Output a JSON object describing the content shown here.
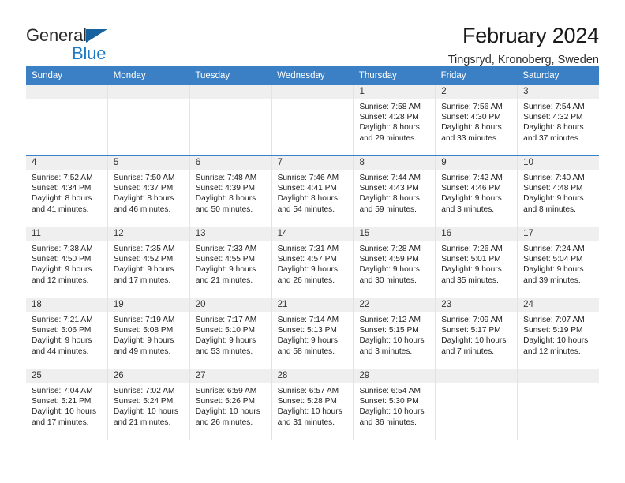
{
  "brand": {
    "name_part1": "General",
    "name_part2": "Blue",
    "triangle_color": "#15629f",
    "blue_color": "#1f7ac4"
  },
  "header": {
    "title": "February 2024",
    "subtitle": "Tingsryd, Kronoberg, Sweden"
  },
  "theme": {
    "header_blue": "#3b7fc4",
    "day_band_gray": "#efefef",
    "cell_border": "#e3e3e3"
  },
  "weekdays": [
    "Sunday",
    "Monday",
    "Tuesday",
    "Wednesday",
    "Thursday",
    "Friday",
    "Saturday"
  ],
  "weeks": [
    [
      {
        "date": "",
        "sunrise": "",
        "sunset": "",
        "daylight_line1": "",
        "daylight_line2": ""
      },
      {
        "date": "",
        "sunrise": "",
        "sunset": "",
        "daylight_line1": "",
        "daylight_line2": ""
      },
      {
        "date": "",
        "sunrise": "",
        "sunset": "",
        "daylight_line1": "",
        "daylight_line2": ""
      },
      {
        "date": "",
        "sunrise": "",
        "sunset": "",
        "daylight_line1": "",
        "daylight_line2": ""
      },
      {
        "date": "1",
        "sunrise": "Sunrise: 7:58 AM",
        "sunset": "Sunset: 4:28 PM",
        "daylight_line1": "Daylight: 8 hours",
        "daylight_line2": "and 29 minutes."
      },
      {
        "date": "2",
        "sunrise": "Sunrise: 7:56 AM",
        "sunset": "Sunset: 4:30 PM",
        "daylight_line1": "Daylight: 8 hours",
        "daylight_line2": "and 33 minutes."
      },
      {
        "date": "3",
        "sunrise": "Sunrise: 7:54 AM",
        "sunset": "Sunset: 4:32 PM",
        "daylight_line1": "Daylight: 8 hours",
        "daylight_line2": "and 37 minutes."
      }
    ],
    [
      {
        "date": "4",
        "sunrise": "Sunrise: 7:52 AM",
        "sunset": "Sunset: 4:34 PM",
        "daylight_line1": "Daylight: 8 hours",
        "daylight_line2": "and 41 minutes."
      },
      {
        "date": "5",
        "sunrise": "Sunrise: 7:50 AM",
        "sunset": "Sunset: 4:37 PM",
        "daylight_line1": "Daylight: 8 hours",
        "daylight_line2": "and 46 minutes."
      },
      {
        "date": "6",
        "sunrise": "Sunrise: 7:48 AM",
        "sunset": "Sunset: 4:39 PM",
        "daylight_line1": "Daylight: 8 hours",
        "daylight_line2": "and 50 minutes."
      },
      {
        "date": "7",
        "sunrise": "Sunrise: 7:46 AM",
        "sunset": "Sunset: 4:41 PM",
        "daylight_line1": "Daylight: 8 hours",
        "daylight_line2": "and 54 minutes."
      },
      {
        "date": "8",
        "sunrise": "Sunrise: 7:44 AM",
        "sunset": "Sunset: 4:43 PM",
        "daylight_line1": "Daylight: 8 hours",
        "daylight_line2": "and 59 minutes."
      },
      {
        "date": "9",
        "sunrise": "Sunrise: 7:42 AM",
        "sunset": "Sunset: 4:46 PM",
        "daylight_line1": "Daylight: 9 hours",
        "daylight_line2": "and 3 minutes."
      },
      {
        "date": "10",
        "sunrise": "Sunrise: 7:40 AM",
        "sunset": "Sunset: 4:48 PM",
        "daylight_line1": "Daylight: 9 hours",
        "daylight_line2": "and 8 minutes."
      }
    ],
    [
      {
        "date": "11",
        "sunrise": "Sunrise: 7:38 AM",
        "sunset": "Sunset: 4:50 PM",
        "daylight_line1": "Daylight: 9 hours",
        "daylight_line2": "and 12 minutes."
      },
      {
        "date": "12",
        "sunrise": "Sunrise: 7:35 AM",
        "sunset": "Sunset: 4:52 PM",
        "daylight_line1": "Daylight: 9 hours",
        "daylight_line2": "and 17 minutes."
      },
      {
        "date": "13",
        "sunrise": "Sunrise: 7:33 AM",
        "sunset": "Sunset: 4:55 PM",
        "daylight_line1": "Daylight: 9 hours",
        "daylight_line2": "and 21 minutes."
      },
      {
        "date": "14",
        "sunrise": "Sunrise: 7:31 AM",
        "sunset": "Sunset: 4:57 PM",
        "daylight_line1": "Daylight: 9 hours",
        "daylight_line2": "and 26 minutes."
      },
      {
        "date": "15",
        "sunrise": "Sunrise: 7:28 AM",
        "sunset": "Sunset: 4:59 PM",
        "daylight_line1": "Daylight: 9 hours",
        "daylight_line2": "and 30 minutes."
      },
      {
        "date": "16",
        "sunrise": "Sunrise: 7:26 AM",
        "sunset": "Sunset: 5:01 PM",
        "daylight_line1": "Daylight: 9 hours",
        "daylight_line2": "and 35 minutes."
      },
      {
        "date": "17",
        "sunrise": "Sunrise: 7:24 AM",
        "sunset": "Sunset: 5:04 PM",
        "daylight_line1": "Daylight: 9 hours",
        "daylight_line2": "and 39 minutes."
      }
    ],
    [
      {
        "date": "18",
        "sunrise": "Sunrise: 7:21 AM",
        "sunset": "Sunset: 5:06 PM",
        "daylight_line1": "Daylight: 9 hours",
        "daylight_line2": "and 44 minutes."
      },
      {
        "date": "19",
        "sunrise": "Sunrise: 7:19 AM",
        "sunset": "Sunset: 5:08 PM",
        "daylight_line1": "Daylight: 9 hours",
        "daylight_line2": "and 49 minutes."
      },
      {
        "date": "20",
        "sunrise": "Sunrise: 7:17 AM",
        "sunset": "Sunset: 5:10 PM",
        "daylight_line1": "Daylight: 9 hours",
        "daylight_line2": "and 53 minutes."
      },
      {
        "date": "21",
        "sunrise": "Sunrise: 7:14 AM",
        "sunset": "Sunset: 5:13 PM",
        "daylight_line1": "Daylight: 9 hours",
        "daylight_line2": "and 58 minutes."
      },
      {
        "date": "22",
        "sunrise": "Sunrise: 7:12 AM",
        "sunset": "Sunset: 5:15 PM",
        "daylight_line1": "Daylight: 10 hours",
        "daylight_line2": "and 3 minutes."
      },
      {
        "date": "23",
        "sunrise": "Sunrise: 7:09 AM",
        "sunset": "Sunset: 5:17 PM",
        "daylight_line1": "Daylight: 10 hours",
        "daylight_line2": "and 7 minutes."
      },
      {
        "date": "24",
        "sunrise": "Sunrise: 7:07 AM",
        "sunset": "Sunset: 5:19 PM",
        "daylight_line1": "Daylight: 10 hours",
        "daylight_line2": "and 12 minutes."
      }
    ],
    [
      {
        "date": "25",
        "sunrise": "Sunrise: 7:04 AM",
        "sunset": "Sunset: 5:21 PM",
        "daylight_line1": "Daylight: 10 hours",
        "daylight_line2": "and 17 minutes."
      },
      {
        "date": "26",
        "sunrise": "Sunrise: 7:02 AM",
        "sunset": "Sunset: 5:24 PM",
        "daylight_line1": "Daylight: 10 hours",
        "daylight_line2": "and 21 minutes."
      },
      {
        "date": "27",
        "sunrise": "Sunrise: 6:59 AM",
        "sunset": "Sunset: 5:26 PM",
        "daylight_line1": "Daylight: 10 hours",
        "daylight_line2": "and 26 minutes."
      },
      {
        "date": "28",
        "sunrise": "Sunrise: 6:57 AM",
        "sunset": "Sunset: 5:28 PM",
        "daylight_line1": "Daylight: 10 hours",
        "daylight_line2": "and 31 minutes."
      },
      {
        "date": "29",
        "sunrise": "Sunrise: 6:54 AM",
        "sunset": "Sunset: 5:30 PM",
        "daylight_line1": "Daylight: 10 hours",
        "daylight_line2": "and 36 minutes."
      },
      {
        "date": "",
        "sunrise": "",
        "sunset": "",
        "daylight_line1": "",
        "daylight_line2": ""
      },
      {
        "date": "",
        "sunrise": "",
        "sunset": "",
        "daylight_line1": "",
        "daylight_line2": ""
      }
    ]
  ]
}
